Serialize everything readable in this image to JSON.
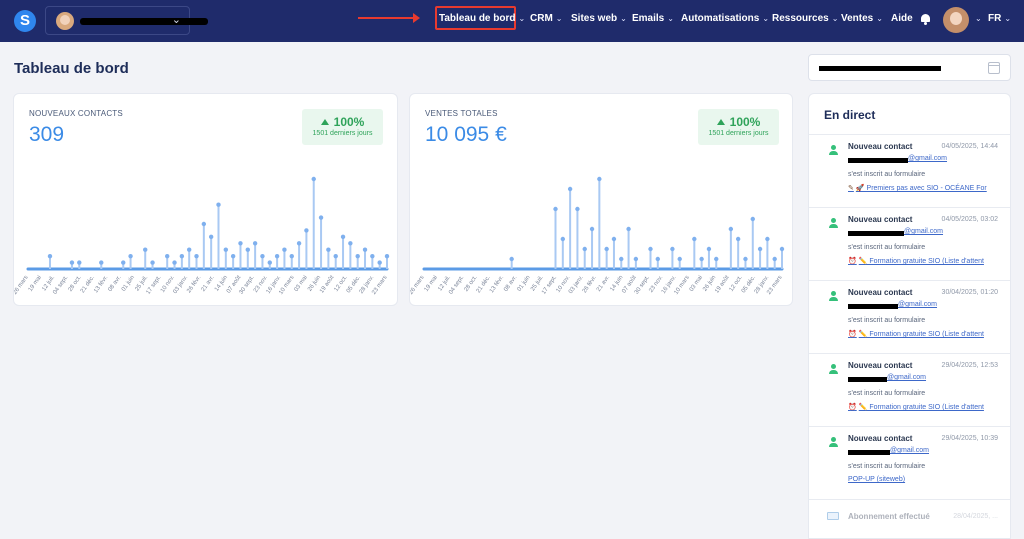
{
  "app": {
    "logo_letter": "S"
  },
  "nav": {
    "items": [
      {
        "label": "Tableau de bord",
        "caret": "⌄"
      },
      {
        "label": "CRM",
        "caret": "⌄"
      },
      {
        "label": "Sites web",
        "caret": "⌄"
      },
      {
        "label": "Emails",
        "caret": "⌄"
      },
      {
        "label": "Automatisations",
        "caret": "⌄"
      },
      {
        "label": "Ressources",
        "caret": "⌄"
      },
      {
        "label": "Ventes",
        "caret": "⌄"
      },
      {
        "label": "Aide",
        "caret": ""
      }
    ],
    "language": "FR",
    "user_caret": "⌄",
    "account_caret": "⌄"
  },
  "page": {
    "title": "Tableau de bord"
  },
  "cards": {
    "contacts": {
      "label": "NOUVEAUX CONTACTS",
      "value": "309",
      "change": "100%",
      "period": "1501 derniers jours"
    },
    "sales": {
      "label": "VENTES TOTALES",
      "value": "10 095 €",
      "change": "100%",
      "period": "1501 derniers jours"
    }
  },
  "chart_data": [
    {
      "type": "scatter",
      "title": "",
      "x_ticks": [
        "26 mars",
        "19 mai",
        "12 juil.",
        "04 sept.",
        "28 oct.",
        "21 déc.",
        "13 févr.",
        "08 avr.",
        "01 juin",
        "25 juil.",
        "17 sept.",
        "10 nov.",
        "03 janv.",
        "26 févr.",
        "21 avr.",
        "14 juin",
        "07 août",
        "30 sept.",
        "23 nov.",
        "16 janv.",
        "10 mars",
        "03 mai",
        "26 juin",
        "19 août",
        "12 oct.",
        "05 déc.",
        "28 janv.",
        "23 mars"
      ],
      "values": [
        0,
        0,
        0,
        2,
        0,
        0,
        1,
        1,
        0,
        0,
        1,
        0,
        0,
        1,
        2,
        0,
        3,
        1,
        0,
        2,
        1,
        2,
        3,
        2,
        7,
        5,
        10,
        3,
        2,
        4,
        3,
        4,
        2,
        1,
        2,
        3,
        2,
        4,
        6,
        14,
        8,
        3,
        2,
        5,
        4,
        2,
        3,
        2,
        1,
        2
      ]
    },
    {
      "type": "scatter",
      "title": "",
      "x_ticks": [
        "26 mars",
        "19 mai",
        "12 juil.",
        "04 sept.",
        "28 oct.",
        "21 déc.",
        "13 févr.",
        "08 avr.",
        "01 juin",
        "25 juil.",
        "17 sept.",
        "10 nov.",
        "03 janv.",
        "26 févr.",
        "21 avr.",
        "14 juin",
        "07 août",
        "30 sept.",
        "23 nov.",
        "16 janv.",
        "10 mars",
        "03 mai",
        "26 juin",
        "19 août",
        "12 oct.",
        "05 déc.",
        "28 janv.",
        "23 mars"
      ],
      "values": [
        0,
        0,
        0,
        0,
        0,
        0,
        0,
        0,
        0,
        0,
        0,
        0,
        1,
        0,
        0,
        0,
        0,
        0,
        6,
        3,
        8,
        6,
        2,
        4,
        9,
        2,
        3,
        1,
        4,
        1,
        0,
        2,
        1,
        0,
        2,
        1,
        0,
        3,
        1,
        2,
        1,
        0,
        4,
        3,
        1,
        5,
        2,
        3,
        1,
        2
      ]
    }
  ],
  "live": {
    "title": "En direct",
    "events": [
      {
        "title": "Nouveau contact",
        "date": "04/05/2025, 14:44",
        "email_suffix": "@gmail.com",
        "message": "s'est inscrit au formulaire",
        "link_icon": "✎",
        "link": "🚀 Premiers pas avec SIO - OCÉANE For"
      },
      {
        "title": "Nouveau contact",
        "date": "04/05/2025, 03:02",
        "email_suffix": "@gmail.com",
        "message": "s'est inscrit au formulaire",
        "link_icon": "⏰",
        "link": "✏️ Formation gratuite SIO (Liste d'attent"
      },
      {
        "title": "Nouveau contact",
        "date": "30/04/2025, 01:20",
        "email_suffix": "@gmail.com",
        "message": "s'est inscrit au formulaire",
        "link_icon": "⏰",
        "link": "✏️ Formation gratuite SIO (Liste d'attent"
      },
      {
        "title": "Nouveau contact",
        "date": "29/04/2025, 12:53",
        "email_suffix": "@gmail.com",
        "message": "s'est inscrit au formulaire",
        "link_icon": "⏰",
        "link": "✏️ Formation gratuite SIO (Liste d'attent"
      },
      {
        "title": "Nouveau contact",
        "date": "29/04/2025, 10:39",
        "email_suffix": "@gmail.com",
        "message": "s'est inscrit au formulaire",
        "link_icon": "",
        "link": "POP-UP (siteweb)"
      }
    ],
    "last": {
      "title": "Abonnement effectué",
      "date": "28/04/2025, ..."
    }
  },
  "colors": {
    "nav_bg": "#1f2b6b",
    "accent": "#3b8be6",
    "positive": "#2fa35a",
    "highlight": "#e83a2f"
  }
}
